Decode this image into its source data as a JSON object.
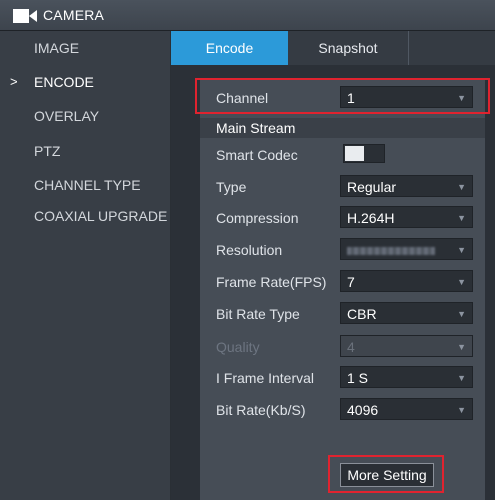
{
  "header": {
    "title": "CAMERA",
    "icon": "video-camera-icon"
  },
  "sidebar": {
    "items": [
      {
        "label": "IMAGE"
      },
      {
        "label": "ENCODE",
        "active": true,
        "marker": ">"
      },
      {
        "label": "OVERLAY"
      },
      {
        "label": "PTZ"
      },
      {
        "label": "CHANNEL TYPE"
      },
      {
        "label": "COAXIAL UPGRADE"
      }
    ]
  },
  "tabs": [
    {
      "label": "Encode",
      "active": true
    },
    {
      "label": "Snapshot",
      "active": false
    }
  ],
  "form": {
    "channel": {
      "label": "Channel",
      "value": "1"
    },
    "section_title": "Main Stream",
    "smart_codec": {
      "label": "Smart Codec",
      "state": "off"
    },
    "type": {
      "label": "Type",
      "value": "Regular"
    },
    "compression": {
      "label": "Compression",
      "value": "H.264H"
    },
    "resolution": {
      "label": "Resolution",
      "value": ""
    },
    "frame_rate": {
      "label": "Frame Rate(FPS)",
      "value": "7"
    },
    "bit_rate_type": {
      "label": "Bit Rate Type",
      "value": "CBR"
    },
    "quality": {
      "label": "Quality",
      "value": "4",
      "disabled": true
    },
    "i_frame_interval": {
      "label": "I Frame Interval",
      "value": "1 S"
    },
    "bit_rate": {
      "label": "Bit Rate(Kb/S)",
      "value": "4096"
    },
    "more_setting_label": "More Setting"
  },
  "colors": {
    "accent": "#2c9ad9",
    "highlight_box": "#e0232f",
    "panel": "#464d56",
    "sidebar": "#383e46"
  }
}
